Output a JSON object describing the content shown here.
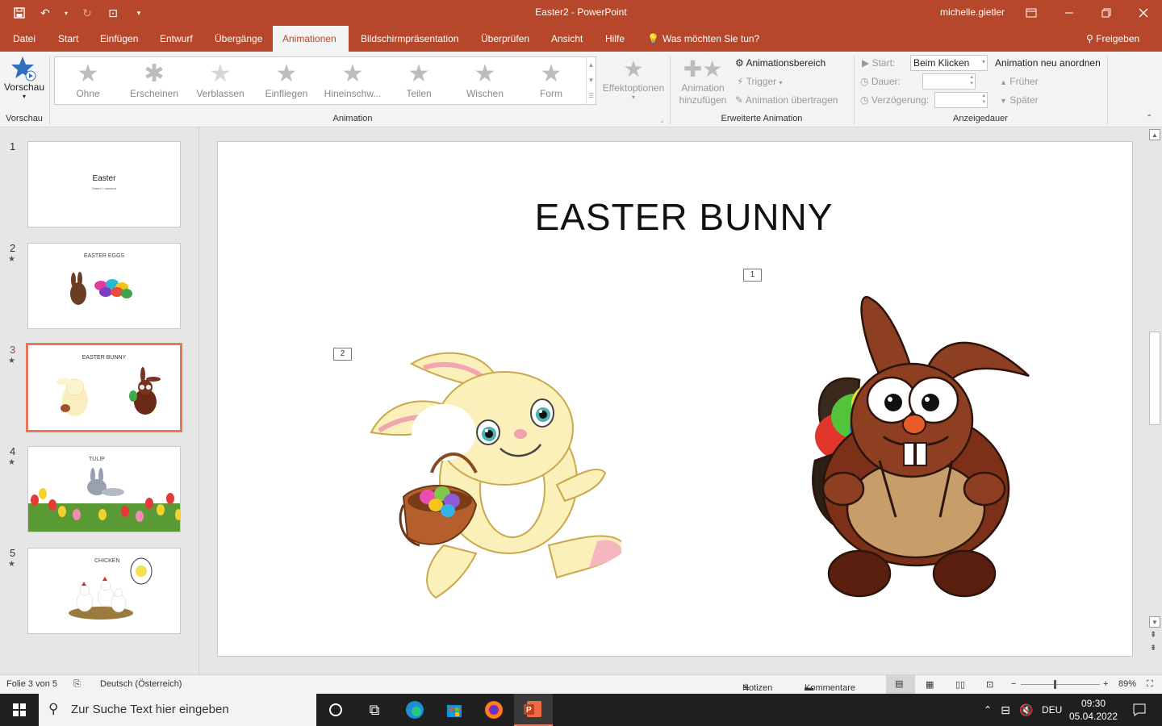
{
  "window": {
    "title": "Easter2  -  PowerPoint",
    "user": "michelle.gietler"
  },
  "tabs": [
    {
      "label": "Datei"
    },
    {
      "label": "Start"
    },
    {
      "label": "Einfügen"
    },
    {
      "label": "Entwurf"
    },
    {
      "label": "Übergänge"
    },
    {
      "label": "Animationen"
    },
    {
      "label": "Bildschirmpräsentation"
    },
    {
      "label": "Überprüfen"
    },
    {
      "label": "Ansicht"
    },
    {
      "label": "Hilfe"
    },
    {
      "label": "Was möchten Sie tun?"
    },
    {
      "label": "Freigeben"
    }
  ],
  "ribbon": {
    "preview": {
      "label": "Vorschau",
      "group": "Vorschau"
    },
    "gallery": [
      {
        "label": "Ohne"
      },
      {
        "label": "Erscheinen"
      },
      {
        "label": "Verblassen"
      },
      {
        "label": "Einfliegen"
      },
      {
        "label": "Hineinschw..."
      },
      {
        "label": "Teilen"
      },
      {
        "label": "Wischen"
      },
      {
        "label": "Form"
      }
    ],
    "effect_options": "Effektoptionen",
    "animation_group": "Animation",
    "add_animation": "Animation\nhinzufügen",
    "animation_pane": "Animationsbereich",
    "trigger": "Trigger",
    "animation_painter": "Animation übertragen",
    "advanced_group": "Erweiterte Animation",
    "start_label": "Start:",
    "start_value": "Beim Klicken",
    "duration_label": "Dauer:",
    "delay_label": "Verzögerung:",
    "reorder": "Animation neu anordnen",
    "earlier": "Früher",
    "later": "Später",
    "timing_group": "Anzeigedauer"
  },
  "thumbnails": [
    {
      "num": "1",
      "title": "Easter",
      "subtitle": "Ostern / ostalova"
    },
    {
      "num": "2",
      "title": "EASTER    EGGS"
    },
    {
      "num": "3",
      "title": "EASTER BUNNY"
    },
    {
      "num": "4",
      "title": "TULIP"
    },
    {
      "num": "5",
      "title": "CHICKEN"
    }
  ],
  "slide": {
    "title": "EASTER BUNNY",
    "tag1": "1",
    "tag2": "2"
  },
  "status": {
    "slide_info": "Folie 3 von 5",
    "language": "Deutsch (Österreich)",
    "notes": "Notizen",
    "comments": "Kommentare",
    "zoom": "89%"
  },
  "taskbar": {
    "search_placeholder": "Zur Suche Text hier eingeben",
    "lang": "DEU",
    "time": "09:30",
    "date": "05.04.2022"
  }
}
